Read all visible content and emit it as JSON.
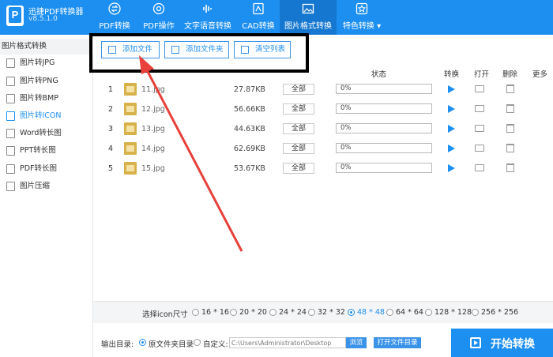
{
  "app": {
    "title": "迅捷PDF转换器",
    "version": "v8.5.1.0",
    "logo_letter": "P"
  },
  "nav": {
    "tabs": [
      {
        "label": "PDF转换",
        "icon": "swap-icon"
      },
      {
        "label": "PDF操作",
        "icon": "gear-icon"
      },
      {
        "label": "文字语音转换",
        "icon": "audio-icon"
      },
      {
        "label": "CAD转换",
        "icon": "cad-icon"
      },
      {
        "label": "图片格式转换",
        "icon": "image-icon",
        "active": true
      },
      {
        "label": "特色转换 ▾",
        "icon": "star-icon"
      }
    ]
  },
  "sidebar": {
    "header": "图片格式转换",
    "items": [
      {
        "label": "图片转JPG"
      },
      {
        "label": "图片转PNG"
      },
      {
        "label": "图片转BMP"
      },
      {
        "label": "图片转ICON",
        "active": true
      },
      {
        "label": "Word转长图"
      },
      {
        "label": "PPT转长图"
      },
      {
        "label": "PDF转长图"
      },
      {
        "label": "图片压缩"
      }
    ]
  },
  "toolbar": {
    "add_file": "添加文件",
    "add_folder": "添加文件夹",
    "clear_list": "清空列表"
  },
  "table": {
    "headers": {
      "status": "状态",
      "convert": "转换",
      "open": "打开",
      "delete": "删除",
      "more": "更多"
    },
    "rows": [
      {
        "num": "1",
        "name": "11.jpg",
        "size": "27.87KB",
        "scope": "全部",
        "progress_text": "0%",
        "progress": 0
      },
      {
        "num": "2",
        "name": "12.jpg",
        "size": "56.66KB",
        "scope": "全部",
        "progress_text": "0%",
        "progress": 0
      },
      {
        "num": "3",
        "name": "13.jpg",
        "size": "44.63KB",
        "scope": "全部",
        "progress_text": "0%",
        "progress": 0
      },
      {
        "num": "4",
        "name": "14.jpg",
        "size": "62.69KB",
        "scope": "全部",
        "progress_text": "0%",
        "progress": 0
      },
      {
        "num": "5",
        "name": "15.jpg",
        "size": "53.67KB",
        "scope": "全部",
        "progress_text": "0%",
        "progress": 0
      }
    ]
  },
  "icon_size": {
    "label": "选择icon尺寸",
    "options": [
      "16 * 16",
      "20 * 20",
      "24 * 24",
      "32 * 32",
      "48 * 48",
      "64 * 64",
      "128 * 128",
      "256 * 256"
    ],
    "selected": "48 * 48"
  },
  "output": {
    "label": "输出目录:",
    "original_folder": "原文件夹目录",
    "custom": "自定义:",
    "path": "C:\\Users\\Administrator\\Desktop",
    "browse": "浏览",
    "open_folder": "打开文件目录"
  },
  "start_button": "开始转换",
  "colors": {
    "accent": "#1d8ff0",
    "annotation_arrow": "#e8403a",
    "highlight_box": "#000000"
  }
}
